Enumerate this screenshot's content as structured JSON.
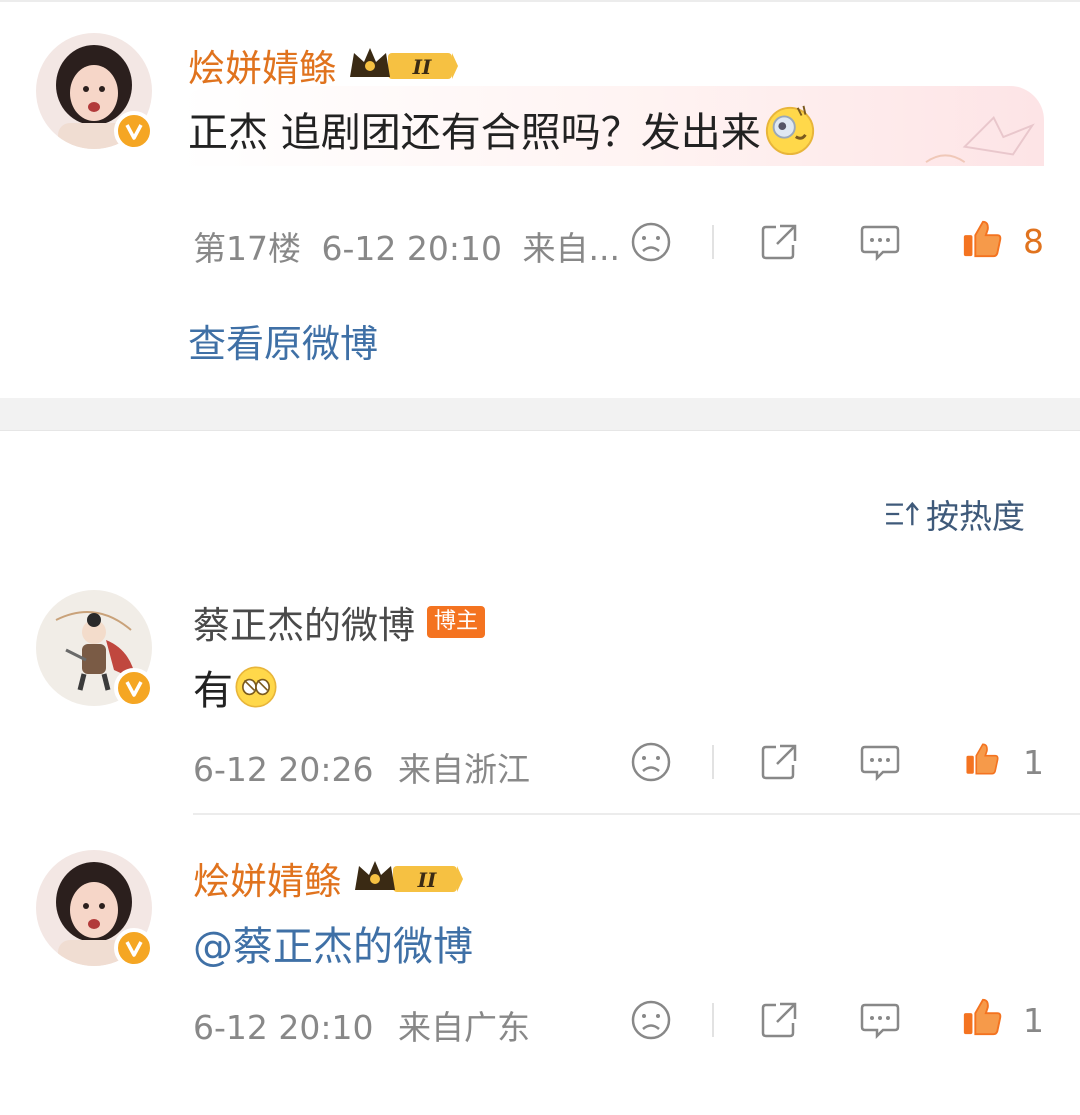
{
  "top_comment": {
    "author": "烩姘婧鲦",
    "vip_level": "II",
    "text": "正杰 追剧团还有合照吗？发出来",
    "floor": "第17楼",
    "time": "6-12 20:10",
    "source": "来自...",
    "like_count": "8",
    "view_original": "查看原微博"
  },
  "sort_label": "按热度",
  "replies": [
    {
      "author": "蔡正杰的微博",
      "badge": "博主",
      "text": "有",
      "time": "6-12 20:26",
      "source": "来自浙江",
      "like_count": "1"
    },
    {
      "author": "烩姘婧鲦",
      "vip_level": "II",
      "text": "@蔡正杰的微博",
      "time": "6-12 20:10",
      "source": "来自广东",
      "like_count": "1"
    }
  ],
  "colors": {
    "vip_name": "#e0731e",
    "link": "#3f70a6",
    "like_active": "#f47320",
    "meta": "#888888",
    "section_gap": "#f2f2f2"
  },
  "icons": [
    "crown-badge-icon",
    "verified-v-icon",
    "dislike-icon",
    "share-icon",
    "comment-icon",
    "like-icon",
    "sort-icon"
  ]
}
